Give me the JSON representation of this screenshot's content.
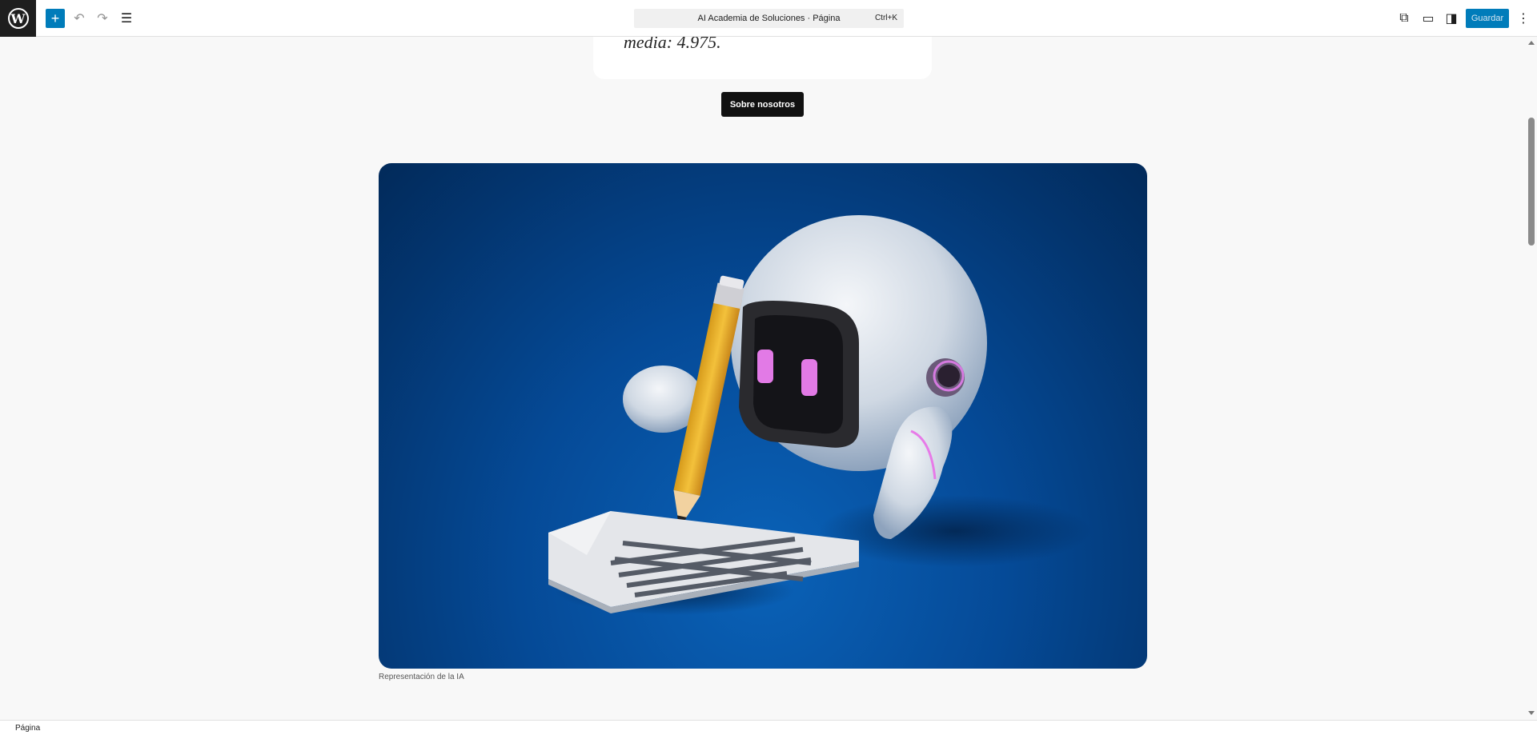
{
  "toolbar": {
    "logo_letter": "W",
    "add_symbol": "+",
    "undo_symbol": "↶",
    "redo_symbol": "↷",
    "list_view_symbol": "☰",
    "document_title": "AI Academia de Soluciones · Página",
    "command_shortcut": "Ctrl+K",
    "view_symbol": "⧉",
    "device_symbol": "▭",
    "settings_symbol": "◨",
    "save_label": "Guardar",
    "more_symbol": "⋮"
  },
  "content": {
    "card_text": "media: 4.975.",
    "about_button_label": "Sobre nosotros",
    "image_caption": "Representación de la IA",
    "image_alt_name": "robot-writing-illustration"
  },
  "footer": {
    "breadcrumb": "Página"
  },
  "colors": {
    "accent": "#007cba",
    "image_background": "#054a97"
  }
}
